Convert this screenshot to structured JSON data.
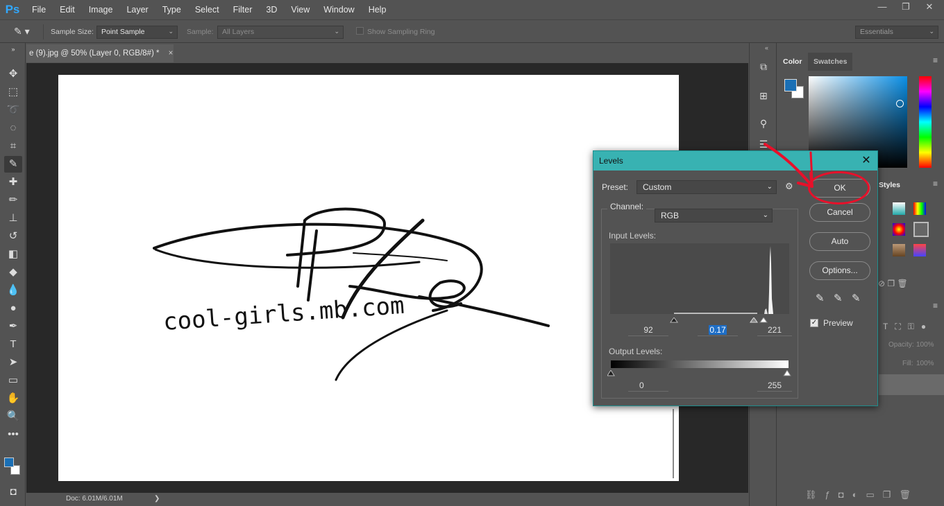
{
  "app": {
    "logo": "Ps",
    "menu": [
      "File",
      "Edit",
      "Image",
      "Layer",
      "Type",
      "Select",
      "Filter",
      "3D",
      "View",
      "Window",
      "Help"
    ],
    "window_controls": [
      "minimize-icon",
      "restore-icon",
      "close-icon"
    ]
  },
  "options_bar": {
    "sample_size_label": "Sample Size:",
    "sample_size_value": "Point Sample",
    "sample_label": "Sample:",
    "sample_value": "All Layers",
    "sampling_ring_label": "Show Sampling Ring",
    "workspace": "Essentials"
  },
  "document": {
    "tab_title": "e (9).jpg @ 50% (Layer 0, RGB/8#) *",
    "tab_close": "×",
    "watermark_text": "cool-girls.mb.com",
    "status": "Doc: 6.01M/6.01M",
    "status_arrow": "❯"
  },
  "panels": {
    "color_tab": "Color",
    "swatches_tab": "Swatches",
    "styles_tab": "Styles",
    "opacity_label": "Opacity:",
    "opacity_value": "100%",
    "fill_label": "Fill:",
    "fill_value": "100%",
    "foreground_color": "#1a6fb5",
    "background_color": "#ffffff"
  },
  "levels": {
    "title": "Levels",
    "preset_label": "Preset:",
    "preset_value": "Custom",
    "channel_label": "Channel:",
    "channel_value": "RGB",
    "input_levels_label": "Input Levels:",
    "input_black": "92",
    "input_gamma": "0.17",
    "input_white": "221",
    "output_levels_label": "Output Levels:",
    "output_black": "0",
    "output_white": "255",
    "buttons": {
      "ok": "OK",
      "cancel": "Cancel",
      "auto": "Auto",
      "options": "Options..."
    },
    "preview_label": "Preview",
    "preview_checked": true
  },
  "colors": {
    "accent_teal": "#38b2b2",
    "annotation_red": "#e8102a"
  }
}
